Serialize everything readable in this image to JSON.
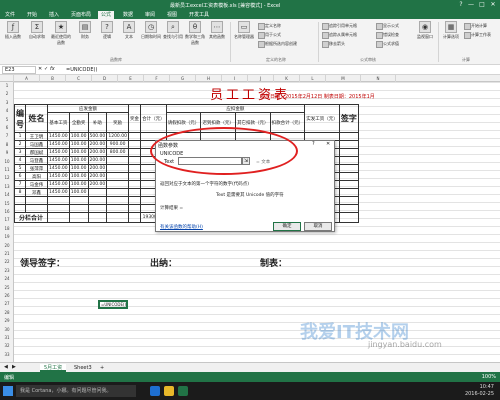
{
  "window": {
    "title": "最新员工excel工资表模板.xls [兼容模式] - Excel",
    "controls": [
      "?",
      "—",
      "□",
      "✕"
    ]
  },
  "ribbon": {
    "tabs": [
      "文件",
      "开始",
      "插入",
      "页面布局",
      "公式",
      "数据",
      "审阅",
      "视图",
      "开发工具"
    ],
    "active_tab": "公式",
    "big_buttons": [
      {
        "label": "插入函数",
        "icon": "fx-icon"
      },
      {
        "label": "自动求和",
        "icon": "sum-icon"
      },
      {
        "label": "最近使用的函数",
        "icon": "star-icon"
      },
      {
        "label": "财务",
        "icon": "book-icon"
      },
      {
        "label": "逻辑",
        "icon": "question-icon"
      },
      {
        "label": "文本",
        "icon": "text-icon"
      },
      {
        "label": "日期和时间",
        "icon": "clock-icon"
      },
      {
        "label": "查找与引用",
        "icon": "search-icon"
      },
      {
        "label": "数学和三角函数",
        "icon": "theta-icon"
      },
      {
        "label": "其他函数",
        "icon": "more-icon"
      },
      {
        "label": "名称管理器",
        "icon": "tag-icon"
      },
      {
        "label": "监视窗口",
        "icon": "watch-icon"
      },
      {
        "label": "计算选项",
        "icon": "calc-icon"
      }
    ],
    "small_buttons": [
      "定义名称",
      "用于公式",
      "根据所选内容创建",
      "追踪引用单元格",
      "追踪从属单元格",
      "移去箭头",
      "显示公式",
      "错误检查",
      "公式求值",
      "开始计算",
      "计算工作表"
    ],
    "groups": [
      "函数库",
      "定义的名称",
      "公式审核",
      "计算"
    ]
  },
  "formula_bar": {
    "name_box": "E23",
    "fx": "fx",
    "formula": "=UNICODE()"
  },
  "columns": [
    "A",
    "B",
    "C",
    "D",
    "E",
    "F",
    "G",
    "H",
    "I",
    "J",
    "K",
    "L",
    "M",
    "N"
  ],
  "rows": [
    "1",
    "2",
    "3",
    "4",
    "5",
    "6",
    "7",
    "8",
    "9",
    "10",
    "11",
    "12",
    "13",
    "14",
    "15",
    "16",
    "17",
    "18",
    "19",
    "20",
    "21",
    "22",
    "23",
    "24",
    "25",
    "26",
    "27",
    "28",
    "29",
    "30",
    "31",
    "32",
    "33"
  ],
  "sheet": {
    "title": "员工工资表",
    "date_text": "发放日期：2015年2月12日  制表日期：2015年1月",
    "headers": {
      "no": "编号",
      "name": "姓名",
      "should_pay": "应发金额",
      "deduct": "应扣金额",
      "basic": "基本工资",
      "bonus": "全勤奖",
      "subsidy": "补助",
      "other": "奖励",
      "perf": "奖金",
      "total": "合计（元）",
      "personal": "请假扣款（元）",
      "late": "迟到扣款（元）",
      "social": "其它扣款（元）",
      "sum_ded": "扣款合计（元）",
      "actual": "实发工资（元）",
      "sign": "签字"
    },
    "rows": [
      {
        "no": "1",
        "name": "王卫明",
        "v": [
          "1450.00",
          "100.00",
          "500.00",
          "1200.00"
        ]
      },
      {
        "no": "2",
        "name": "马国鑫",
        "v": [
          "1450.00",
          "100.00",
          "200.00",
          "900.00"
        ]
      },
      {
        "no": "3",
        "name": "郝国斌",
        "v": [
          "1450.00",
          "100.00",
          "200.00",
          "800.00"
        ]
      },
      {
        "no": "4",
        "name": "马登鑫",
        "v": [
          "1450.00",
          "100.00",
          "200.00",
          ""
        ]
      },
      {
        "no": "5",
        "name": "张萍萍",
        "v": [
          "1450.00",
          "100.00",
          "200.00",
          ""
        ]
      },
      {
        "no": "6",
        "name": "高阳",
        "v": [
          "1450.00",
          "100.00",
          "200.00",
          ""
        ]
      },
      {
        "no": "7",
        "name": "马金伟",
        "v": [
          "1450.00",
          "100.00",
          "200.00",
          ""
        ]
      },
      {
        "no": "8",
        "name": "邓鑫",
        "v": [
          "1450.00",
          "100.00",
          "",
          ""
        ]
      }
    ],
    "subtotal_label": "分栏合计",
    "subtotal_values": {
      "total": "19300.00",
      "actual": "18770.00"
    },
    "signatures": {
      "leader": "领导签字：",
      "cashier": "出纳：",
      "maker": "制表："
    },
    "active_cell_text": "=UNICODE()"
  },
  "dialog": {
    "title": "函数参数",
    "func_name": "UNICODE",
    "arg_label": "Text",
    "arg_eq": "=  文本",
    "description": "返回对应于文本的第一个字符的数字(代码点)",
    "arg_description": "Text   是需要其 Unicode 值的字符",
    "result_label": "计算结果 =",
    "help_link": "有关该函数的帮助(H)",
    "ok": "确定",
    "cancel": "取消"
  },
  "sheet_tabs": [
    "5月工资",
    "Sheet3",
    "+"
  ],
  "status": {
    "left": "编辑",
    "zoom": "100%"
  },
  "taskbar": {
    "search": "我是 Cortana，小娜。有问题尽管问我。",
    "time": "10:47",
    "date": "2016-02-25"
  },
  "watermark": {
    "text": "我爱IT技术网",
    "url": "jingyan.baidu.com"
  }
}
